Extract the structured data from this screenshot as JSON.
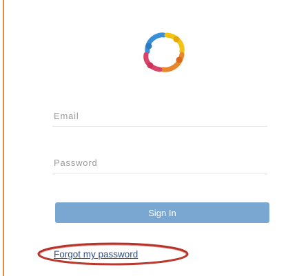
{
  "top_cut_text": "...   ...   ....   ...   ...   ...   ...   ...",
  "logo": {
    "icon": "people-circle-logo",
    "colors": [
      "#e84c3d",
      "#f39c12",
      "#f1c40f",
      "#3498db",
      "#9b59b6",
      "#e74c3c"
    ]
  },
  "form": {
    "email_placeholder": "Email",
    "password_placeholder": "Password",
    "email_value": "",
    "password_value": "",
    "sign_in_label": "Sign In",
    "forgot_password_label": "Forgot my password"
  },
  "annotation": {
    "highlight_color": "#b5332a"
  },
  "colors": {
    "border_accent": "#e58b3a",
    "button_bg": "#7aa7d2",
    "link": "#2f4f86"
  }
}
